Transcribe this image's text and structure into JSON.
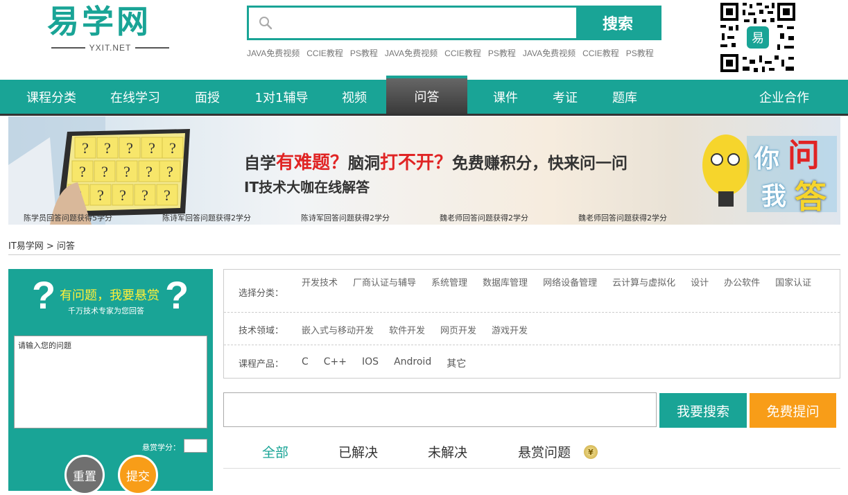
{
  "header": {
    "logo_text": "易学网",
    "logo_sub": "YXIT.NET",
    "search_button": "搜索",
    "hot_links": [
      "JAVA免费视频",
      "CCIE教程",
      "PS教程",
      "JAVA免费视频",
      "CCIE教程",
      "PS教程",
      "JAVA免费视频",
      "CCIE教程",
      "PS教程"
    ],
    "qr_logo": "易"
  },
  "nav": {
    "items": [
      "课程分类",
      "在线学习",
      "面授",
      "1对1辅导",
      "视频",
      "问答",
      "课件",
      "考证",
      "题库",
      "企业合作"
    ],
    "active": "问答"
  },
  "banner": {
    "line1_a": "自学",
    "line1_b": "有难题？",
    "line1_c": "脑洞",
    "line1_d": "打不开？",
    "line1_e": "免费赚积分，快来问一问",
    "line2": "IT技术大咖在线解答",
    "badge_a": "你",
    "badge_b": "问",
    "badge_c": "我",
    "badge_d": "答",
    "ticker": [
      "陈学员回答问题获得5学分",
      "陈诗军回答问题获得2学分",
      "陈诗军回答问题获得2学分",
      "魏老师回答问题获得2学分",
      "魏老师回答问题获得2学分"
    ]
  },
  "breadcrumb": {
    "home": "IT易学网",
    "sep": ">",
    "current": "问答"
  },
  "ask": {
    "title": "有问题，我要悬赏",
    "subtitle": "千万技术专家为您回答",
    "qmark": "?",
    "placeholder": "请输入您的问题",
    "reward_label": "悬赏学分：",
    "reset": "重置",
    "submit": "提交"
  },
  "filters": {
    "category_label": "选择分类：",
    "categories": [
      "开发技术",
      "厂商认证与辅导",
      "系统管理",
      "数据库管理",
      "网络设备管理",
      "云计算与虚拟化",
      "设计",
      "办公软件",
      "国家认证"
    ],
    "field_label": "技术领域：",
    "fields": [
      "嵌入式与移动开发",
      "软件开发",
      "网页开发",
      "游戏开发"
    ],
    "product_label": "课程产品：",
    "products": [
      "C",
      "C++",
      "IOS",
      "Android",
      "其它"
    ]
  },
  "question_search": {
    "search_button": "我要搜索",
    "ask_button": "免费提问"
  },
  "tabs": {
    "all": "全部",
    "solved": "已解决",
    "unsolved": "未解决",
    "reward": "悬赏问题",
    "coin": "¥"
  },
  "colors": {
    "brand": "#19a496",
    "accent": "#f89d18",
    "nav_active": "#3a3a3a"
  }
}
